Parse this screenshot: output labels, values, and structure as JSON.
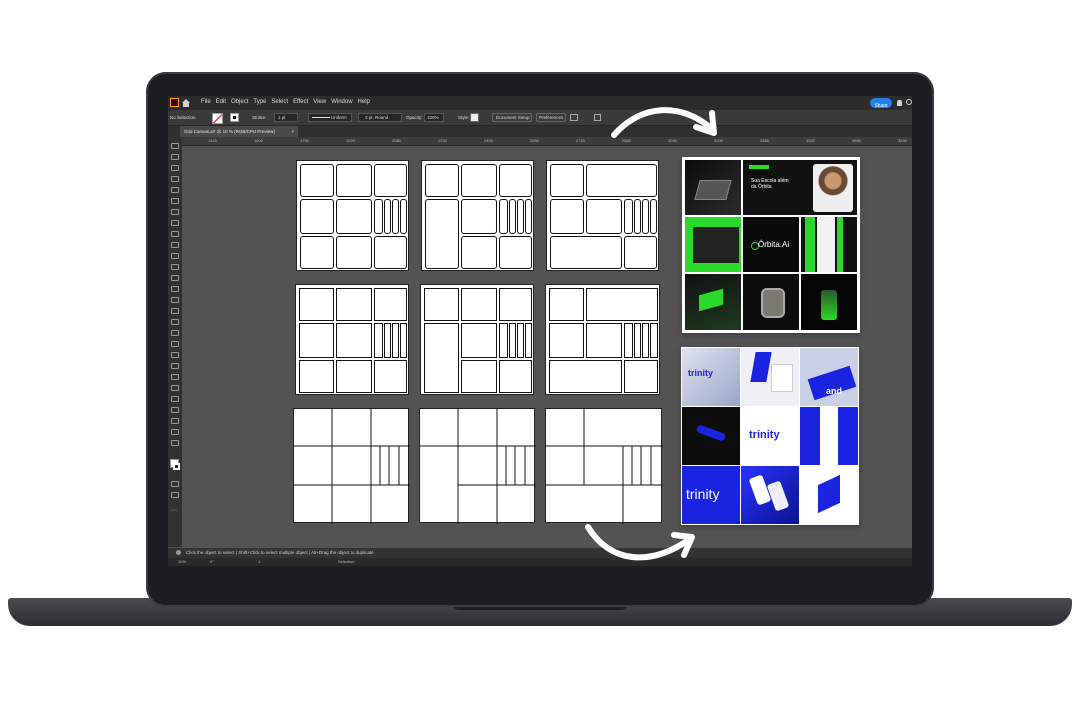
{
  "app": {
    "menu": [
      "File",
      "Edit",
      "Object",
      "Type",
      "Select",
      "Effect",
      "View",
      "Window",
      "Help"
    ],
    "share_label": "Share"
  },
  "options_bar": {
    "selection": "No Selection",
    "stroke_label": "Stroke:",
    "stroke_value": "1 pt",
    "uniform": "Uniform",
    "brush": "3 pt. Round",
    "opacity_label": "Opacity:",
    "opacity_value": "100%",
    "style_label": "Style:",
    "doc_setup": "Document Setup",
    "preferences": "Preferences"
  },
  "document_tab": {
    "title": "Grid Canvas.ai* @ 10 % (RGB/CPU Preview)",
    "close": "×"
  },
  "ruler_ticks": [
    "1440",
    "1600",
    "1760",
    "1920",
    "2080",
    "2240",
    "2400",
    "2560",
    "2720",
    "2880",
    "3040",
    "3200",
    "3360",
    "3520",
    "3680",
    "3840"
  ],
  "status": {
    "hint": "Click the object to select  |  Shift+Click to select multiple object  |  Alt+Drag the object to duplicate"
  },
  "bottom": {
    "zoom": "10%",
    "rotation": "0°",
    "page": "1",
    "mode": "Selection"
  },
  "collage_green": {
    "hero_text": "Sua Escola além da Órbita",
    "brand": "Órbita.Ai"
  },
  "collage_blue": {
    "brand": "trinity",
    "brand2": "trinity",
    "brand3": "trinity",
    "fragment": "and"
  },
  "colors": {
    "accent_green": "#2bd92b",
    "accent_blue": "#1a24e0",
    "canvas": "#535353",
    "share_blue": "#2680eb"
  }
}
